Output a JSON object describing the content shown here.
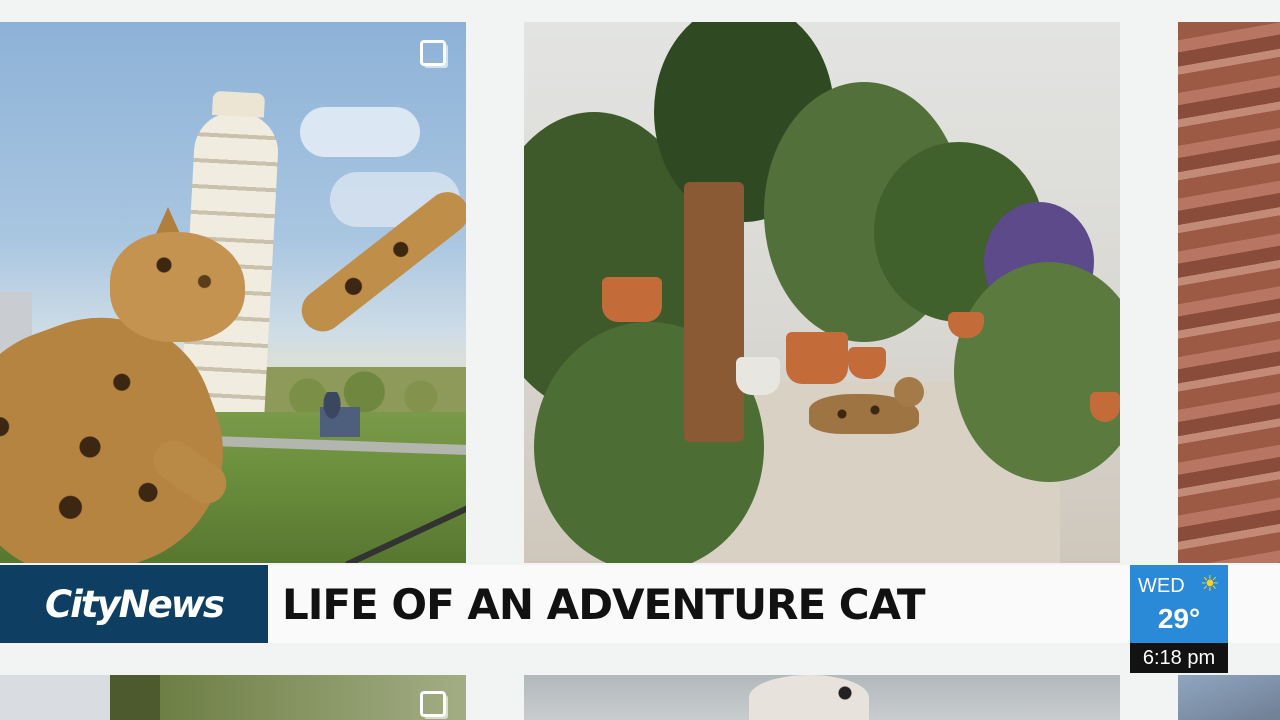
{
  "broadcast": {
    "brand": "CityNews",
    "headline": "LIFE OF AN ADVENTURE CAT",
    "weather": {
      "day": "WED",
      "temperature": "29°",
      "condition_icon": "sun-icon"
    },
    "time": "6:18 pm"
  },
  "feed": {
    "tiles": [
      {
        "subject": "cat-pisa-photo",
        "multi_icon": "multiple-photos-icon"
      },
      {
        "subject": "cat-plants-photo"
      },
      {
        "subject": "red-rock-photo"
      },
      {
        "subject": "bottom-left-photo",
        "multi_icon": "multiple-photos-icon"
      },
      {
        "subject": "dog-photo"
      },
      {
        "subject": "mountain-photo"
      }
    ]
  },
  "colors": {
    "brand_blue": "#0e3e62",
    "weather_blue": "#2a8ad8",
    "sun_yellow": "#ffd21e",
    "clock_black": "#121212"
  }
}
